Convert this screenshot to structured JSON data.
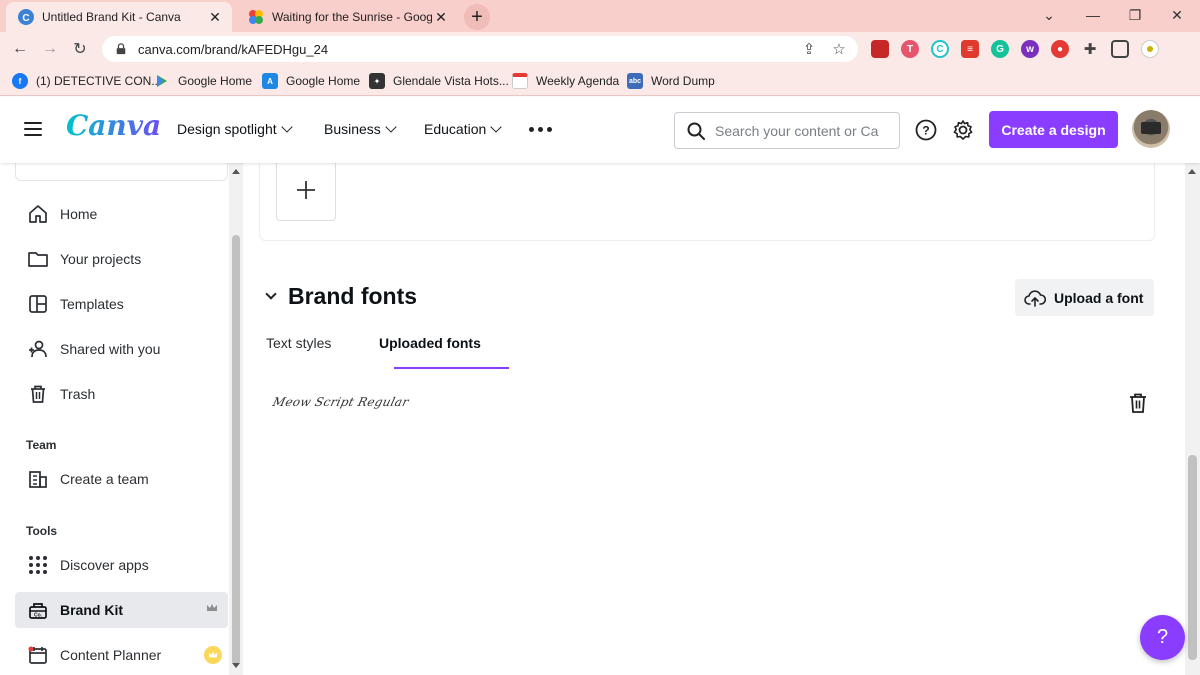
{
  "browser": {
    "tabs": [
      {
        "title": "Untitled Brand Kit - Canva",
        "active": true
      },
      {
        "title": "Waiting for the Sunrise - Google",
        "active": false
      }
    ],
    "url": "canva.com/brand/kAFEDHgu_24",
    "bookmarks": [
      {
        "label": "(1) DETECTIVE CON...",
        "icon": "facebook-icon"
      },
      {
        "label": "Google Home",
        "icon": "play-store-icon"
      },
      {
        "label": "Google Home",
        "icon": "app-store-icon"
      },
      {
        "label": "Glendale Vista Hots...",
        "icon": "site-icon"
      },
      {
        "label": "Weekly Agenda",
        "icon": "calendar-icon"
      },
      {
        "label": "Word Dump",
        "icon": "abc-icon"
      }
    ]
  },
  "header": {
    "logo": "Canva",
    "nav": [
      {
        "label": "Design spotlight"
      },
      {
        "label": "Business"
      },
      {
        "label": "Education"
      }
    ],
    "search_placeholder": "Search your content or Ca",
    "create_label": "Create a design"
  },
  "sidebar": {
    "items": [
      {
        "label": "Home",
        "icon": "home-icon"
      },
      {
        "label": "Your projects",
        "icon": "folder-icon"
      },
      {
        "label": "Templates",
        "icon": "templates-icon"
      },
      {
        "label": "Shared with you",
        "icon": "shared-users-icon"
      },
      {
        "label": "Trash",
        "icon": "trash-icon"
      }
    ],
    "team_heading": "Team",
    "team_items": [
      {
        "label": "Create a team",
        "icon": "building-icon"
      }
    ],
    "tools_heading": "Tools",
    "tools_items": [
      {
        "label": "Discover apps",
        "icon": "apps-grid-icon"
      },
      {
        "label": "Brand Kit",
        "icon": "brand-kit-icon",
        "active": true
      },
      {
        "label": "Content Planner",
        "icon": "calendar-icon"
      }
    ]
  },
  "main": {
    "section_title": "Brand fonts",
    "upload_label": "Upload a font",
    "tabs": [
      {
        "label": "Text styles",
        "active": false
      },
      {
        "label": "Uploaded fonts",
        "active": true
      }
    ],
    "fonts": [
      {
        "name": "Meow Script Regular"
      }
    ]
  },
  "help_label": "?",
  "colors": {
    "accent": "#8b3dff",
    "brand_teal": "#00c4cc"
  }
}
